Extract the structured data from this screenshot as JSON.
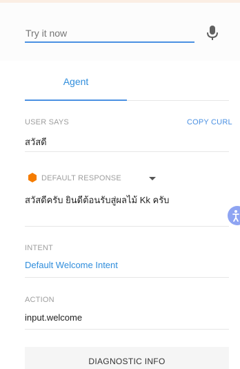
{
  "try_it": {
    "placeholder": "Try it now"
  },
  "tabs": {
    "agent_label": "Agent"
  },
  "user_says": {
    "label": "USER SAYS",
    "copy_curl": "COPY CURL",
    "value": "สวัสดี"
  },
  "default_response": {
    "label": "DEFAULT RESPONSE",
    "value": "สวัสดีครับ ยินดีต้อนรับสู่ผลไม้ Kk ครับ"
  },
  "intent": {
    "label": "INTENT",
    "value": "Default Welcome Intent"
  },
  "action": {
    "label": "ACTION",
    "value": "input.welcome"
  },
  "diagnostic": {
    "label": "DIAGNOSTIC INFO"
  },
  "icons": {
    "mic": "microphone-icon",
    "response": "hexagon-icon",
    "dropdown": "caret-down-icon",
    "accessibility": "accessibility-icon"
  },
  "colors": {
    "accent": "#4a90e2",
    "response_icon": "#f57c00",
    "accessibility_bg": "#8ea4f2"
  }
}
